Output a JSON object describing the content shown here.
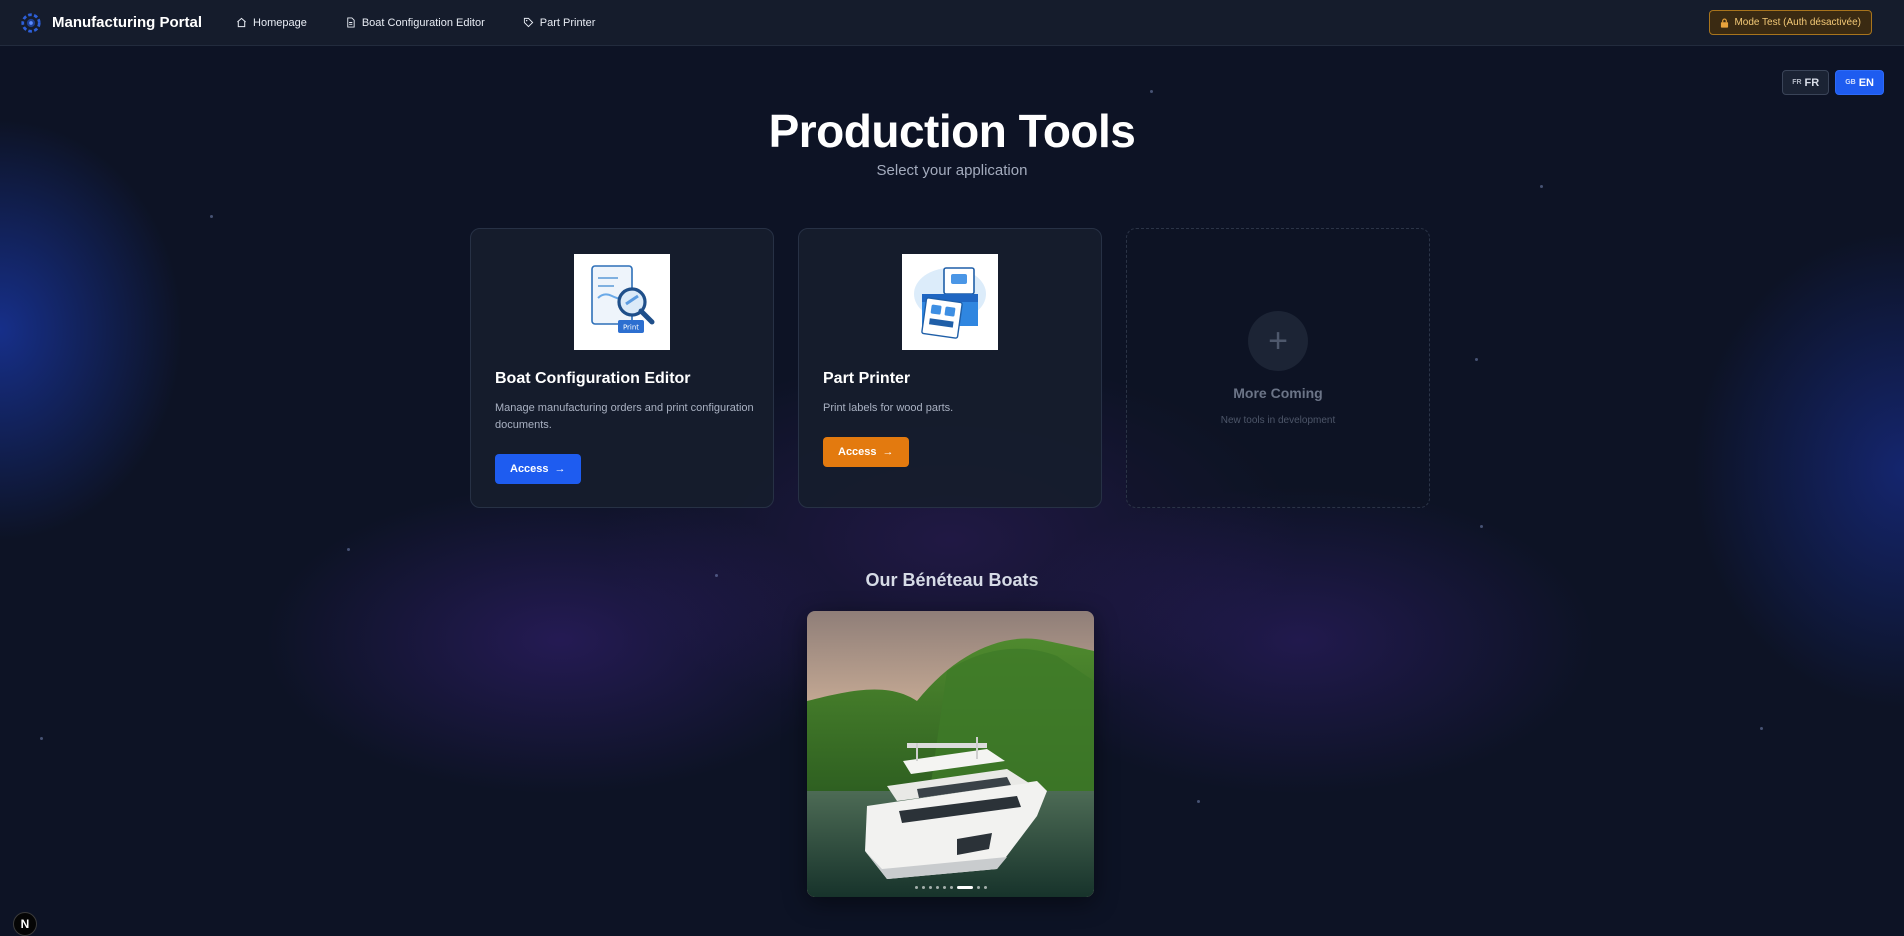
{
  "app": {
    "brand": "Manufacturing Portal",
    "brand_icon": "gear-logo-icon"
  },
  "nav": {
    "items": [
      {
        "label": "Homepage",
        "icon": "home-icon"
      },
      {
        "label": "Boat Configuration Editor",
        "icon": "document-icon"
      },
      {
        "label": "Part Printer",
        "icon": "tag-icon"
      }
    ]
  },
  "mode_badge": {
    "label": "Mode Test (Auth désactivée)",
    "icon": "lock-icon",
    "color": "#f3c977"
  },
  "language": {
    "options": [
      {
        "flag": "FR",
        "label": "FR",
        "selected": false
      },
      {
        "flag": "GB",
        "label": "EN",
        "selected": true
      }
    ]
  },
  "header": {
    "title": "Production Tools",
    "subtitle": "Select your application"
  },
  "cards": [
    {
      "title": "Boat Configuration Editor",
      "description": "Manage manufacturing orders and print configuration documents.",
      "button": "Access",
      "button_color": "#1e5cf0",
      "image_label": "Print"
    },
    {
      "title": "Part Printer",
      "description": "Print labels for wood parts.",
      "button": "Access",
      "button_color": "#e37a0f"
    }
  ],
  "coming_card": {
    "title": "More Coming",
    "subtitle": "New tools in development"
  },
  "boats": {
    "title": "Our Bénéteau Boats",
    "slide_count": 9,
    "active_slide": 6
  },
  "dev_badge": {
    "label": "N"
  }
}
